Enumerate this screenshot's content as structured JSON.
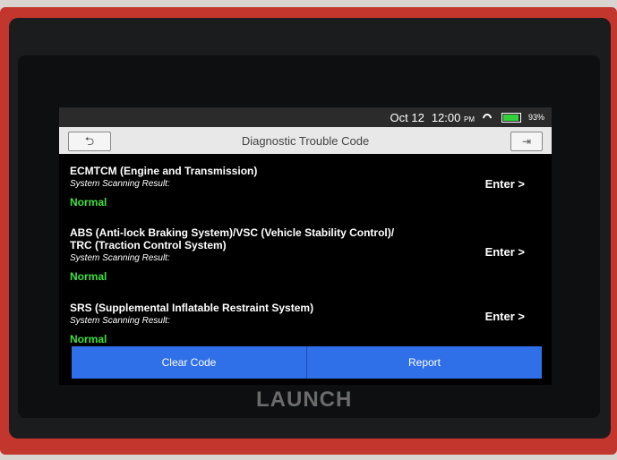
{
  "status": {
    "date": "Oct 12",
    "time": "12:00",
    "time_suffix": "PM",
    "battery_pct": "93%"
  },
  "header": {
    "title": "Diagnostic Trouble Code",
    "back_icon": "⮌",
    "exit_icon": "⇥"
  },
  "systems": [
    {
      "title_line1": "ECMTCM (Engine and Transmission)",
      "title_line2": "",
      "label": "System Scanning Result:",
      "status": "Normal",
      "enter": "Enter >"
    },
    {
      "title_line1": "ABS (Anti-lock Braking System)/VSC (Vehicle Stability Control)/",
      "title_line2": "TRC (Traction Control System)",
      "label": "System Scanning Result:",
      "status": "Normal",
      "enter": "Enter >"
    },
    {
      "title_line1": "SRS (Supplemental Inflatable Restraint System)",
      "title_line2": "",
      "label": "System Scanning Result:",
      "status": "Normal",
      "enter": "Enter >"
    }
  ],
  "footer": {
    "clear_code": "Clear Code",
    "report": "Report"
  },
  "device": {
    "brand": "LAUNCH"
  },
  "colors": {
    "accent": "#2f6fe8",
    "status_ok": "#3ee03e",
    "casing": "#c3362d"
  }
}
